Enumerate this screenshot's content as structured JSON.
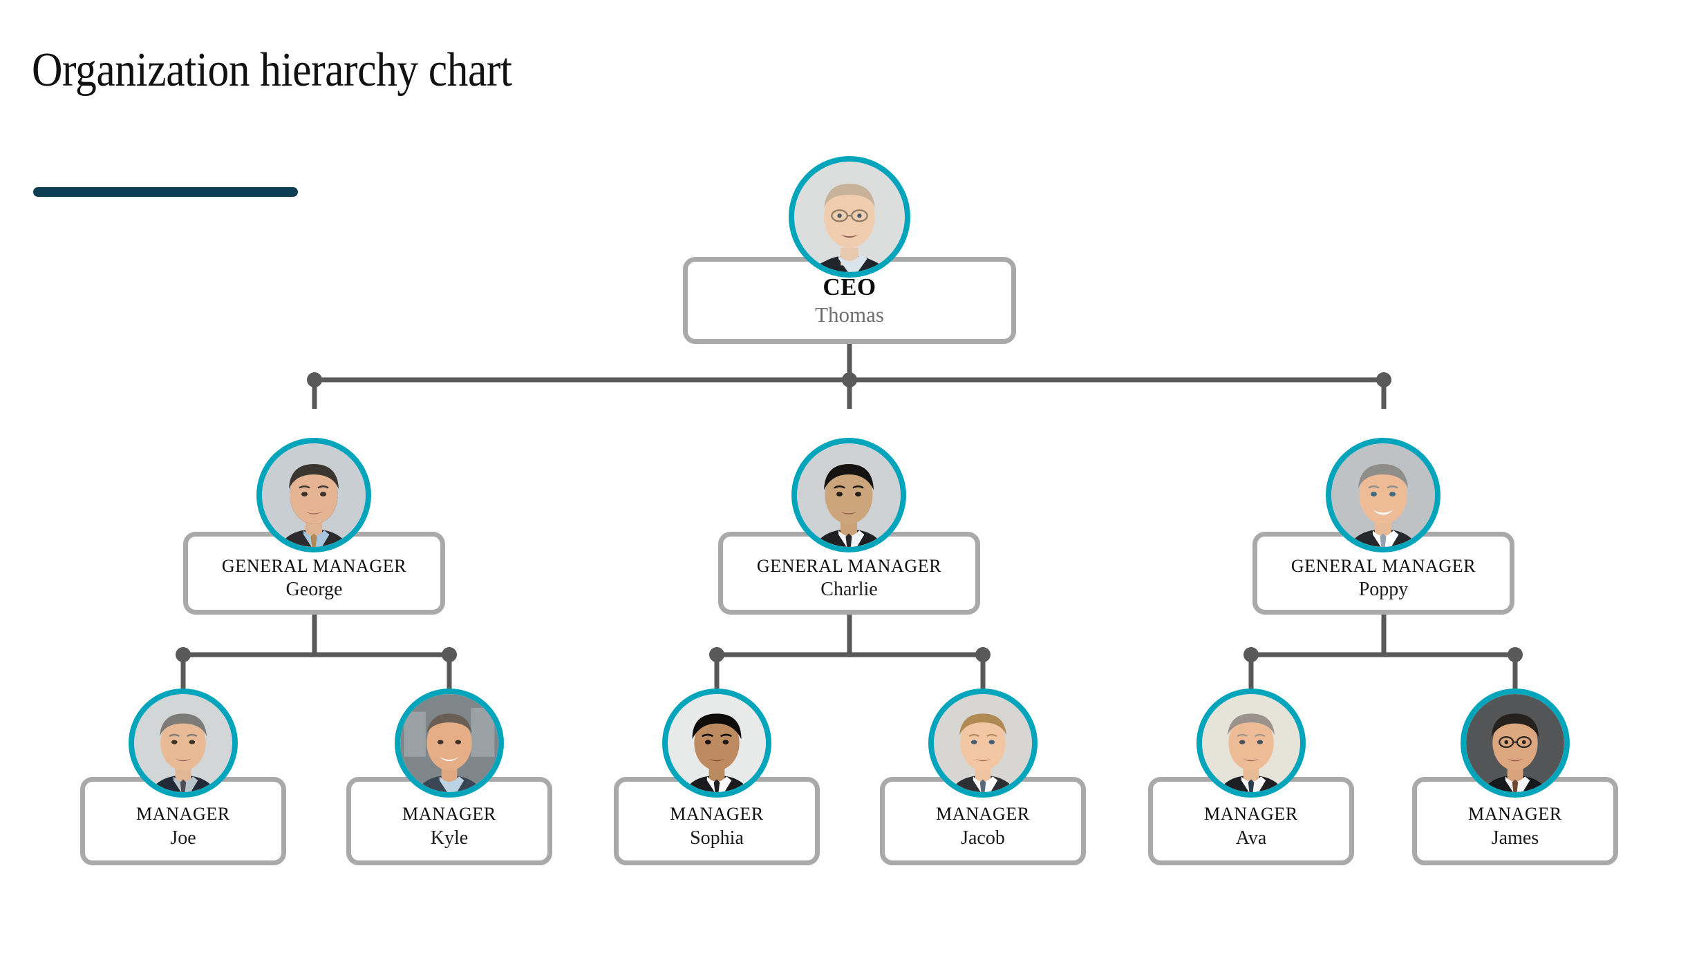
{
  "header": {
    "title": "Organization hierarchy chart",
    "rule_color": "#0e3e54"
  },
  "theme": {
    "accent_ring": "#00a5bc",
    "card_border": "#a9a9a9",
    "connector": "#595959",
    "title_color": "#111111",
    "subtitle_gray": "#6f6f6f",
    "background": "#ffffff"
  },
  "chart_data": {
    "type": "tree",
    "title": "Organization hierarchy chart",
    "levels": [
      "CEO",
      "GENERAL MANAGER",
      "MANAGER"
    ],
    "nodes": [
      {
        "id": "ceo",
        "role": "CEO",
        "name": "Thomas",
        "level": 1,
        "parent": null
      },
      {
        "id": "gm1",
        "role": "GENERAL MANAGER",
        "name": "George",
        "level": 2,
        "parent": "ceo"
      },
      {
        "id": "gm2",
        "role": "GENERAL MANAGER",
        "name": "Charlie",
        "level": 2,
        "parent": "ceo"
      },
      {
        "id": "gm3",
        "role": "GENERAL MANAGER",
        "name": "Poppy",
        "level": 2,
        "parent": "ceo"
      },
      {
        "id": "m1",
        "role": "MANAGER",
        "name": "Joe",
        "level": 3,
        "parent": "gm1"
      },
      {
        "id": "m2",
        "role": "MANAGER",
        "name": "Kyle",
        "level": 3,
        "parent": "gm1"
      },
      {
        "id": "m3",
        "role": "MANAGER",
        "name": "Sophia",
        "level": 3,
        "parent": "gm2"
      },
      {
        "id": "m4",
        "role": "MANAGER",
        "name": "Jacob",
        "level": 3,
        "parent": "gm2"
      },
      {
        "id": "m5",
        "role": "MANAGER",
        "name": "Ava",
        "level": 3,
        "parent": "gm3"
      },
      {
        "id": "m6",
        "role": "MANAGER",
        "name": "James",
        "level": 3,
        "parent": "gm3"
      }
    ]
  },
  "nodes": {
    "ceo": {
      "role": "CEO",
      "name": "Thomas",
      "avatar_name": "portrait-thomas"
    },
    "gm1": {
      "role": "GENERAL MANAGER",
      "name": "George",
      "avatar_name": "portrait-george"
    },
    "gm2": {
      "role": "GENERAL MANAGER",
      "name": "Charlie",
      "avatar_name": "portrait-charlie"
    },
    "gm3": {
      "role": "GENERAL MANAGER",
      "name": "Poppy",
      "avatar_name": "portrait-poppy"
    },
    "m1": {
      "role": "MANAGER",
      "name": "Joe",
      "avatar_name": "portrait-joe"
    },
    "m2": {
      "role": "MANAGER",
      "name": "Kyle",
      "avatar_name": "portrait-kyle"
    },
    "m3": {
      "role": "MANAGER",
      "name": "Sophia",
      "avatar_name": "portrait-sophia"
    },
    "m4": {
      "role": "MANAGER",
      "name": "Jacob",
      "avatar_name": "portrait-jacob"
    },
    "m5": {
      "role": "MANAGER",
      "name": "Ava",
      "avatar_name": "portrait-ava"
    },
    "m6": {
      "role": "MANAGER",
      "name": "James",
      "avatar_name": "portrait-james"
    }
  }
}
